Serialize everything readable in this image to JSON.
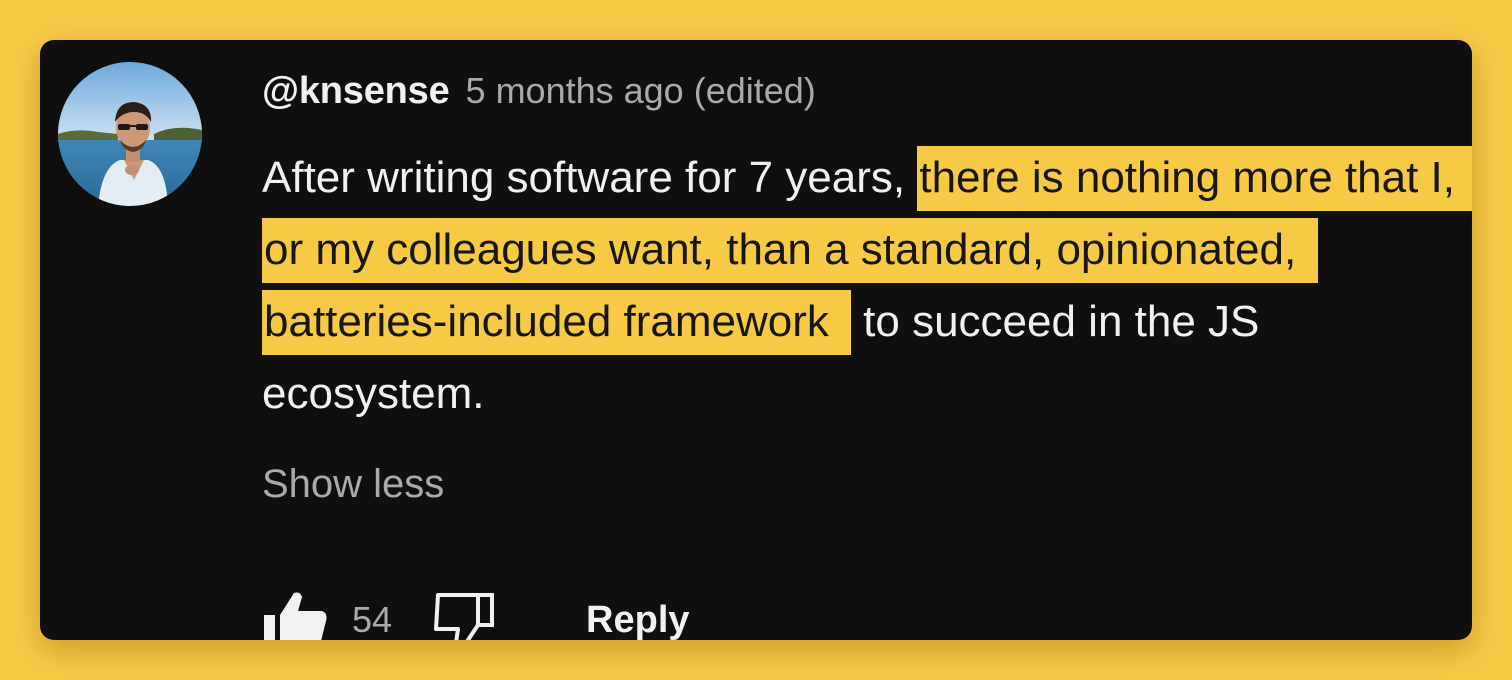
{
  "comment": {
    "author": "@knsense",
    "timestamp": "5 months ago",
    "edited_label": "(edited)",
    "text_before": "After writing software for 7 years, ",
    "text_highlighted": "there is nothing more that I, or my colleagues want, than a standard, opinionated, batteries-included framework",
    "text_after": " to succeed in the JS ecosystem.",
    "show_less_label": "Show less",
    "like_count": "54",
    "reply_label": "Reply"
  },
  "icons": {
    "like": "thumbs-up-icon",
    "dislike": "thumbs-down-icon",
    "avatar": "user-avatar-photo"
  },
  "colors": {
    "page_background": "#f6ca45",
    "card_background": "#0f0f0f",
    "highlight": "#f6ca45",
    "primary_text": "#f1f1f1",
    "secondary_text": "#aaaaaa"
  }
}
